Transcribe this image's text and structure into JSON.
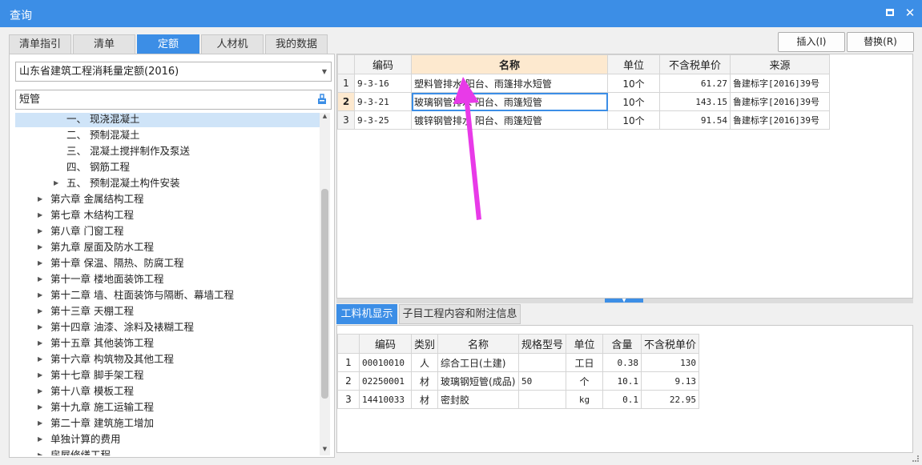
{
  "window": {
    "title": "查询"
  },
  "tabs": [
    "清单指引",
    "清单",
    "定额",
    "人材机",
    "我的数据"
  ],
  "active_tab": 2,
  "buttons": {
    "insert": "插入(I)",
    "replace": "替换(R)"
  },
  "library_select": "山东省建筑工程消耗量定额(2016)",
  "search_value": "短管",
  "tree": [
    {
      "label": "一、 现浇混凝土",
      "level": 2,
      "expandable": false,
      "selected": true
    },
    {
      "label": "二、 预制混凝土",
      "level": 2,
      "expandable": false
    },
    {
      "label": "三、 混凝土搅拌制作及泵送",
      "level": 2,
      "expandable": false
    },
    {
      "label": "四、 钢筋工程",
      "level": 2,
      "expandable": false
    },
    {
      "label": "五、 预制混凝土构件安装",
      "level": 2,
      "expandable": true
    },
    {
      "label": "第六章 金属结构工程",
      "level": 1,
      "expandable": true
    },
    {
      "label": "第七章 木结构工程",
      "level": 1,
      "expandable": true
    },
    {
      "label": "第八章 门窗工程",
      "level": 1,
      "expandable": true
    },
    {
      "label": "第九章 屋面及防水工程",
      "level": 1,
      "expandable": true
    },
    {
      "label": "第十章 保温、隔热、防腐工程",
      "level": 1,
      "expandable": true
    },
    {
      "label": "第十一章 楼地面装饰工程",
      "level": 1,
      "expandable": true
    },
    {
      "label": "第十二章 墙、柱面装饰与隔断、幕墙工程",
      "level": 1,
      "expandable": true
    },
    {
      "label": "第十三章 天棚工程",
      "level": 1,
      "expandable": true
    },
    {
      "label": "第十四章 油漆、涂料及裱糊工程",
      "level": 1,
      "expandable": true
    },
    {
      "label": "第十五章 其他装饰工程",
      "level": 1,
      "expandable": true
    },
    {
      "label": "第十六章 构筑物及其他工程",
      "level": 1,
      "expandable": true
    },
    {
      "label": "第十七章 脚手架工程",
      "level": 1,
      "expandable": true
    },
    {
      "label": "第十八章 模板工程",
      "level": 1,
      "expandable": true
    },
    {
      "label": "第十九章 施工运输工程",
      "level": 1,
      "expandable": true
    },
    {
      "label": "第二十章 建筑施工增加",
      "level": 1,
      "expandable": true
    },
    {
      "label": "单独计算的费用",
      "level": 1,
      "expandable": true
    },
    {
      "label": "房屋修缮工程",
      "level": 1,
      "expandable": true
    }
  ],
  "quota_table": {
    "headers": [
      "",
      "编码",
      "名称",
      "单位",
      "不含税单价",
      "来源"
    ],
    "rows": [
      {
        "no": "1",
        "code": "9-3-16",
        "name": "塑料管排水 阳台、雨篷排水短管",
        "unit": "10个",
        "price": "61.27",
        "source": "鲁建标字[2016]39号"
      },
      {
        "no": "2",
        "code": "9-3-21",
        "name": "玻璃钢管排水 阳台、雨篷短管",
        "unit": "10个",
        "price": "143.15",
        "source": "鲁建标字[2016]39号"
      },
      {
        "no": "3",
        "code": "9-3-25",
        "name": "镀锌钢管排水 阳台、雨篷短管",
        "unit": "10个",
        "price": "91.54",
        "source": "鲁建标字[2016]39号"
      }
    ],
    "selected_row": 1
  },
  "bottom_tabs": [
    "工料机显示",
    "子目工程内容和附注信息"
  ],
  "material_table": {
    "headers": [
      "",
      "编码",
      "类别",
      "名称",
      "规格型号",
      "单位",
      "含量",
      "不含税单价"
    ],
    "rows": [
      {
        "no": "1",
        "code": "00010010",
        "type": "人",
        "name": "综合工日(土建)",
        "spec": "",
        "unit": "工日",
        "qty": "0.38",
        "price": "130"
      },
      {
        "no": "2",
        "code": "02250001",
        "type": "材",
        "name": "玻璃钢短管(成品)",
        "spec": "50",
        "unit": "个",
        "qty": "10.1",
        "price": "9.13"
      },
      {
        "no": "3",
        "code": "14410033",
        "type": "材",
        "name": "密封胶",
        "spec": "",
        "unit": "kg",
        "qty": "0.1",
        "price": "22.95"
      }
    ]
  },
  "colors": {
    "accent": "#3c8ee6",
    "annotation": "#e83ae8",
    "highlight": "#fde9cf"
  }
}
